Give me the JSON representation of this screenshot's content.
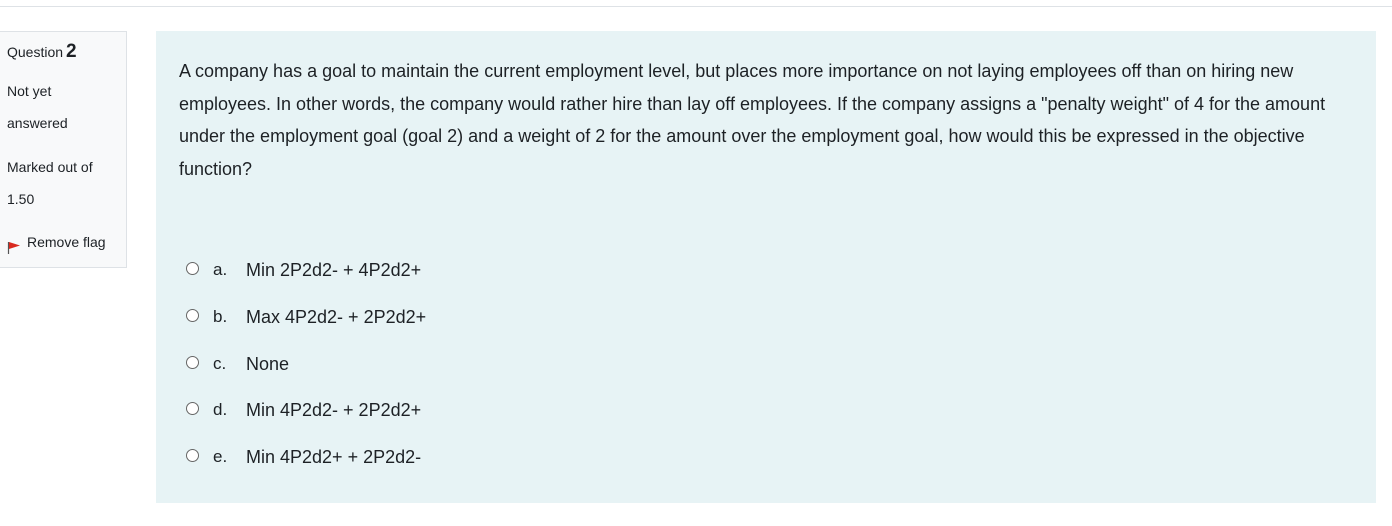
{
  "question_info": {
    "label": "Question",
    "number": "2",
    "state_line1": "Not yet",
    "state_line2": "answered",
    "grade_line1": "Marked out of",
    "grade_line2": "1.50",
    "flag_label": "Remove flag",
    "flag_color": "#d9291f"
  },
  "question": {
    "text": "A company has a goal to maintain the current employment level, but places more importance on not laying employees off than on hiring new employees. In other words, the company would rather hire than lay off employees. If the company assigns a \"penalty weight\" of 4 for the amount under the employment goal (goal 2) and a weight of 2 for the amount over the employment goal, how would this be expressed in the objective function?"
  },
  "answers": [
    {
      "letter": "a.",
      "text": "Min 2P2d2- + 4P2d2+",
      "selected": false
    },
    {
      "letter": "b.",
      "text": "Max 4P2d2- + 2P2d2+",
      "selected": false
    },
    {
      "letter": "c.",
      "text": "None",
      "selected": false
    },
    {
      "letter": "d.",
      "text": "Min 4P2d2- + 2P2d2+",
      "selected": false
    },
    {
      "letter": "e.",
      "text": "Min 4P2d2+ + 2P2d2-",
      "selected": false
    }
  ],
  "colors": {
    "content_background": "#e7f3f5",
    "info_background": "#f8f9fa"
  }
}
